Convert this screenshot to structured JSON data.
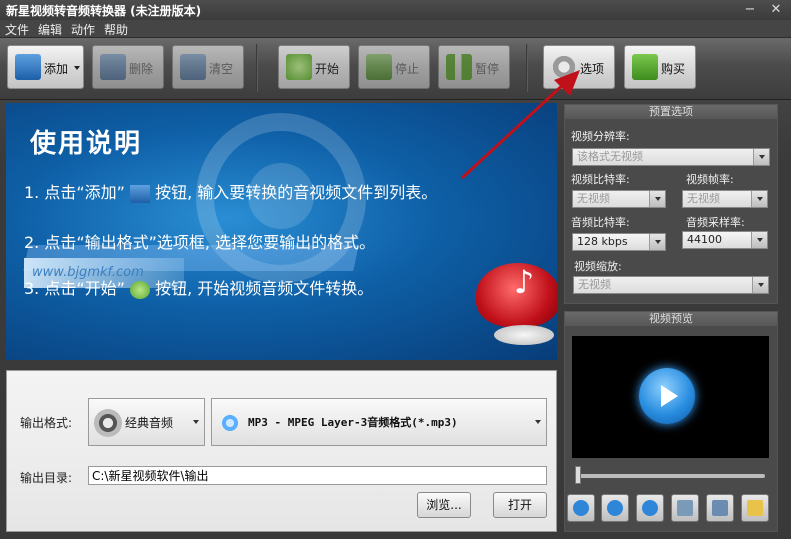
{
  "window": {
    "title": "新星视频转音频转换器 (未注册版本)"
  },
  "menu": {
    "items": [
      {
        "label": "文件"
      },
      {
        "label": "编辑"
      },
      {
        "label": "动作"
      },
      {
        "label": "帮助"
      }
    ]
  },
  "toolbar": {
    "add_label": "添加",
    "remove_label": "删除",
    "clear_label": "清空",
    "start_label": "开始",
    "stop_label": "停止",
    "pause_label": "暂停",
    "options_label": "选项",
    "buy_label": "购买"
  },
  "banner": {
    "heading": "使用说明",
    "line1_a": "1. 点击“添加”",
    "line1_b": "按钮, 输入要转换的音视频文件到列表。",
    "line2": "2. 点击“输出格式”选项框, 选择您要输出的格式。",
    "line3_a": "3. 点击“开始”",
    "line3_b": "按钮, 开始视频音频文件转换。",
    "watermark": "www.bjgmkf.com"
  },
  "preset": {
    "title": "预置选项",
    "video_resolution_label": "视频分辨率:",
    "video_resolution_value": "该格式无视频",
    "video_bitrate_label": "视频比特率:",
    "video_bitrate_value": "无视频",
    "video_framerate_label": "视频帧率:",
    "video_framerate_value": "无视频",
    "audio_bitrate_label": "音频比特率:",
    "audio_bitrate_value": "128 kbps",
    "audio_samplerate_label": "音频采样率:",
    "audio_samplerate_value": "44100",
    "video_scale_label": "视频缩放:",
    "video_scale_value": "无视频"
  },
  "preview": {
    "title": "视频预览"
  },
  "output": {
    "format_label": "输出格式:",
    "category_value": "经典音频",
    "format_value": "MP3 - MPEG Layer-3音频格式(*.mp3)",
    "dir_label": "输出目录:",
    "dir_value": "C:\\新星视频软件\\输出",
    "browse_label": "浏览...",
    "open_label": "打开"
  },
  "colors": {
    "accent": "#2f86d8",
    "banner_bg": "#0e5fa6",
    "arrow": "#c0101a"
  }
}
